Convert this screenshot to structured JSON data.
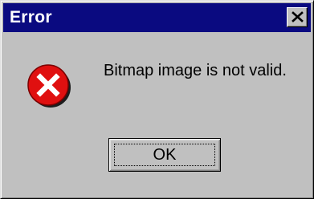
{
  "window": {
    "title": "Error",
    "close_icon": "close-icon",
    "titlebar_color": "#0a0a80",
    "face_color": "#c0c0c0"
  },
  "dialog": {
    "icon": "error-icon",
    "icon_color": "#e01010",
    "message": "Bitmap image is not valid.",
    "ok_label": "OK"
  }
}
